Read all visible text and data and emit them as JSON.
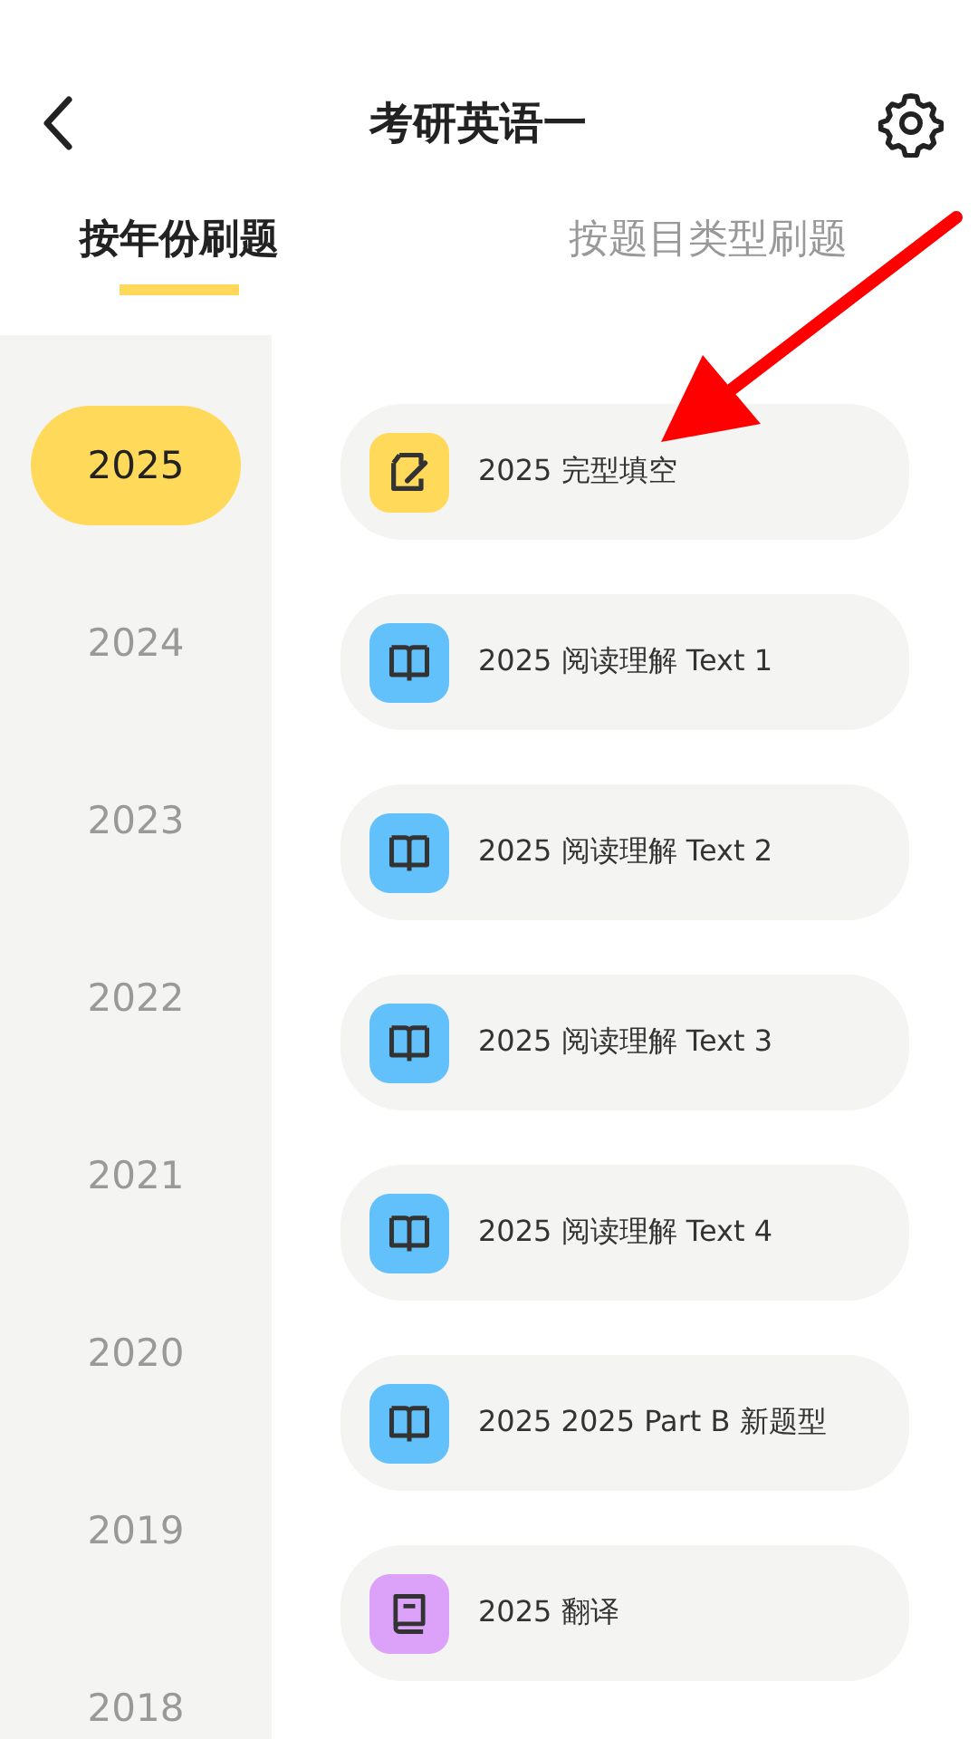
{
  "header": {
    "title": "考研英语一"
  },
  "tabs": [
    {
      "label": "按年份刷题",
      "selected": true
    },
    {
      "label": "按题目类型刷题",
      "selected": false
    }
  ],
  "years": [
    {
      "label": "2025",
      "selected": true
    },
    {
      "label": "2024",
      "selected": false
    },
    {
      "label": "2023",
      "selected": false
    },
    {
      "label": "2022",
      "selected": false
    },
    {
      "label": "2021",
      "selected": false
    },
    {
      "label": "2020",
      "selected": false
    },
    {
      "label": "2019",
      "selected": false
    },
    {
      "label": "2018",
      "selected": false
    }
  ],
  "exercises": [
    {
      "kind": "cloze",
      "title": "2025 完型填空"
    },
    {
      "kind": "reading",
      "title": "2025 阅读理解 Text 1"
    },
    {
      "kind": "reading",
      "title": "2025 阅读理解 Text 2"
    },
    {
      "kind": "reading",
      "title": "2025 阅读理解 Text 3"
    },
    {
      "kind": "reading",
      "title": "2025 阅读理解 Text 4"
    },
    {
      "kind": "reading",
      "title": "2025 2025 Part B 新题型"
    },
    {
      "kind": "translation",
      "title": "2025 翻译"
    }
  ]
}
